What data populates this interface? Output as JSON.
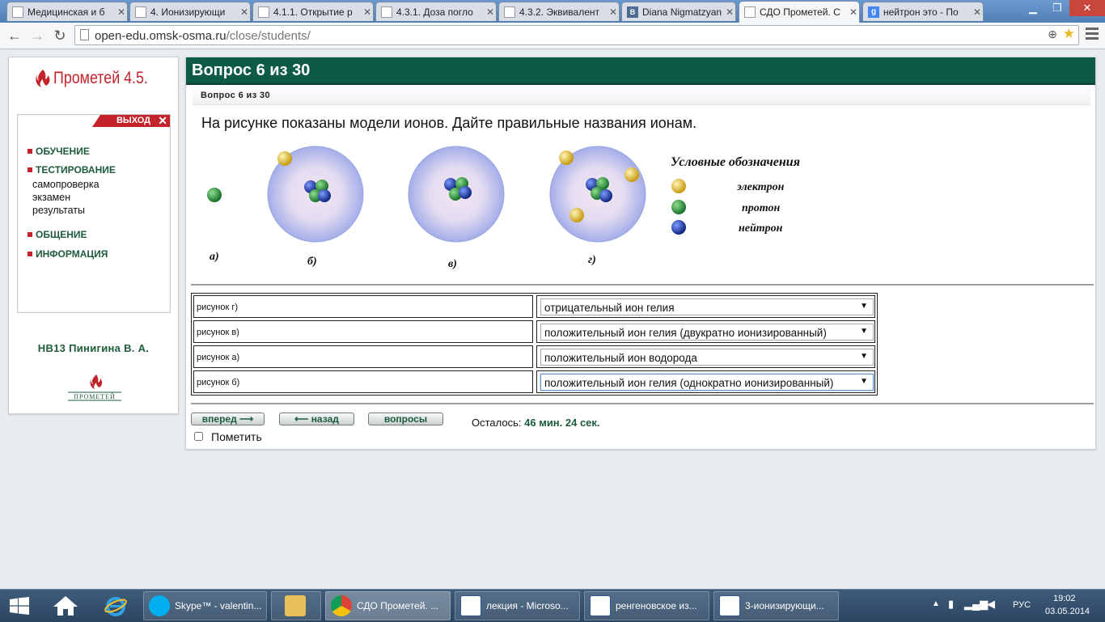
{
  "browser": {
    "tabs": [
      {
        "title": "Медицинская и б",
        "icon": "page"
      },
      {
        "title": "4. Ионизирующи",
        "icon": "page"
      },
      {
        "title": "4.1.1. Открытие р",
        "icon": "page"
      },
      {
        "title": "4.3.1. Доза погло",
        "icon": "page"
      },
      {
        "title": "4.3.2. Эквивалент",
        "icon": "page"
      },
      {
        "title": "Diana Nigmatzyan",
        "icon": "vk",
        "badge": "B"
      },
      {
        "title": "СДО Прометей. С",
        "icon": "page",
        "active": true
      },
      {
        "title": "нейтрон это - По",
        "icon": "google",
        "badge": "g"
      }
    ],
    "url_host": "open-edu.omsk-osma.ru",
    "url_path": "/close/students/"
  },
  "sidebar": {
    "logo_text": "Прометей 4.5.",
    "logout_label": "ВЫХОД",
    "menu": {
      "learning": "ОБУЧЕНИЕ",
      "testing": "ТЕСТИРОВАНИЕ",
      "testing_sub": [
        "самопроверка",
        "экзамен",
        "результаты"
      ],
      "communication": "ОБЩЕНИЕ",
      "info": "ИНФОРМАЦИЯ"
    },
    "user": "НВ13 Пинигина В. А.",
    "small_logo_text": "ПРОМЕТЕЙ"
  },
  "main": {
    "header": "Вопрос 6 из 30",
    "subheader": "Вопрос 6 из 30",
    "question": "На рисунке показаны модели ионов. Дайте правильные названия ионам.",
    "figures": {
      "labels": {
        "a": "а)",
        "b": "б)",
        "v": "в)",
        "g": "г)"
      },
      "legend_title": "Условные обозначения",
      "legend": {
        "electron": "электрон",
        "proton": "протон",
        "neutron": "нейтрон"
      },
      "colors": {
        "electron": "#e8c33a",
        "proton": "#2e9b3e",
        "neutron": "#1d3fae",
        "shell": "#a9b2ea"
      }
    },
    "answers": [
      {
        "label": "рисунок г)",
        "value": "отрицательный ион гелия"
      },
      {
        "label": "рисунок в)",
        "value": "положительный ион гелия (двукратно ионизированный)"
      },
      {
        "label": "рисунок а)",
        "value": "положительный ион водорода"
      },
      {
        "label": "рисунок б)",
        "value": "положительный ион гелия (однократно ионизированный)"
      }
    ],
    "buttons": {
      "forward": "вперед",
      "back": "назад",
      "questions": "вопросы"
    },
    "remaining_label": "Осталось:",
    "remaining_value": "46 мин. 24 сек.",
    "mark_label": "Пометить"
  },
  "taskbar": {
    "items": [
      {
        "label": "Skype™ - valentin...",
        "icon": "skype-icon"
      },
      {
        "label": "",
        "icon": "folder-icon"
      },
      {
        "label": "СДО Прометей. ...",
        "icon": "chrome-icon",
        "active": true
      },
      {
        "label": "лекция - Microso...",
        "icon": "word-icon"
      },
      {
        "label": "ренгеновское из...",
        "icon": "word-icon"
      },
      {
        "label": "3-ионизирующи...",
        "icon": "word-icon"
      }
    ],
    "lang": "РУС",
    "time": "19:02",
    "date": "03.05.2014"
  }
}
